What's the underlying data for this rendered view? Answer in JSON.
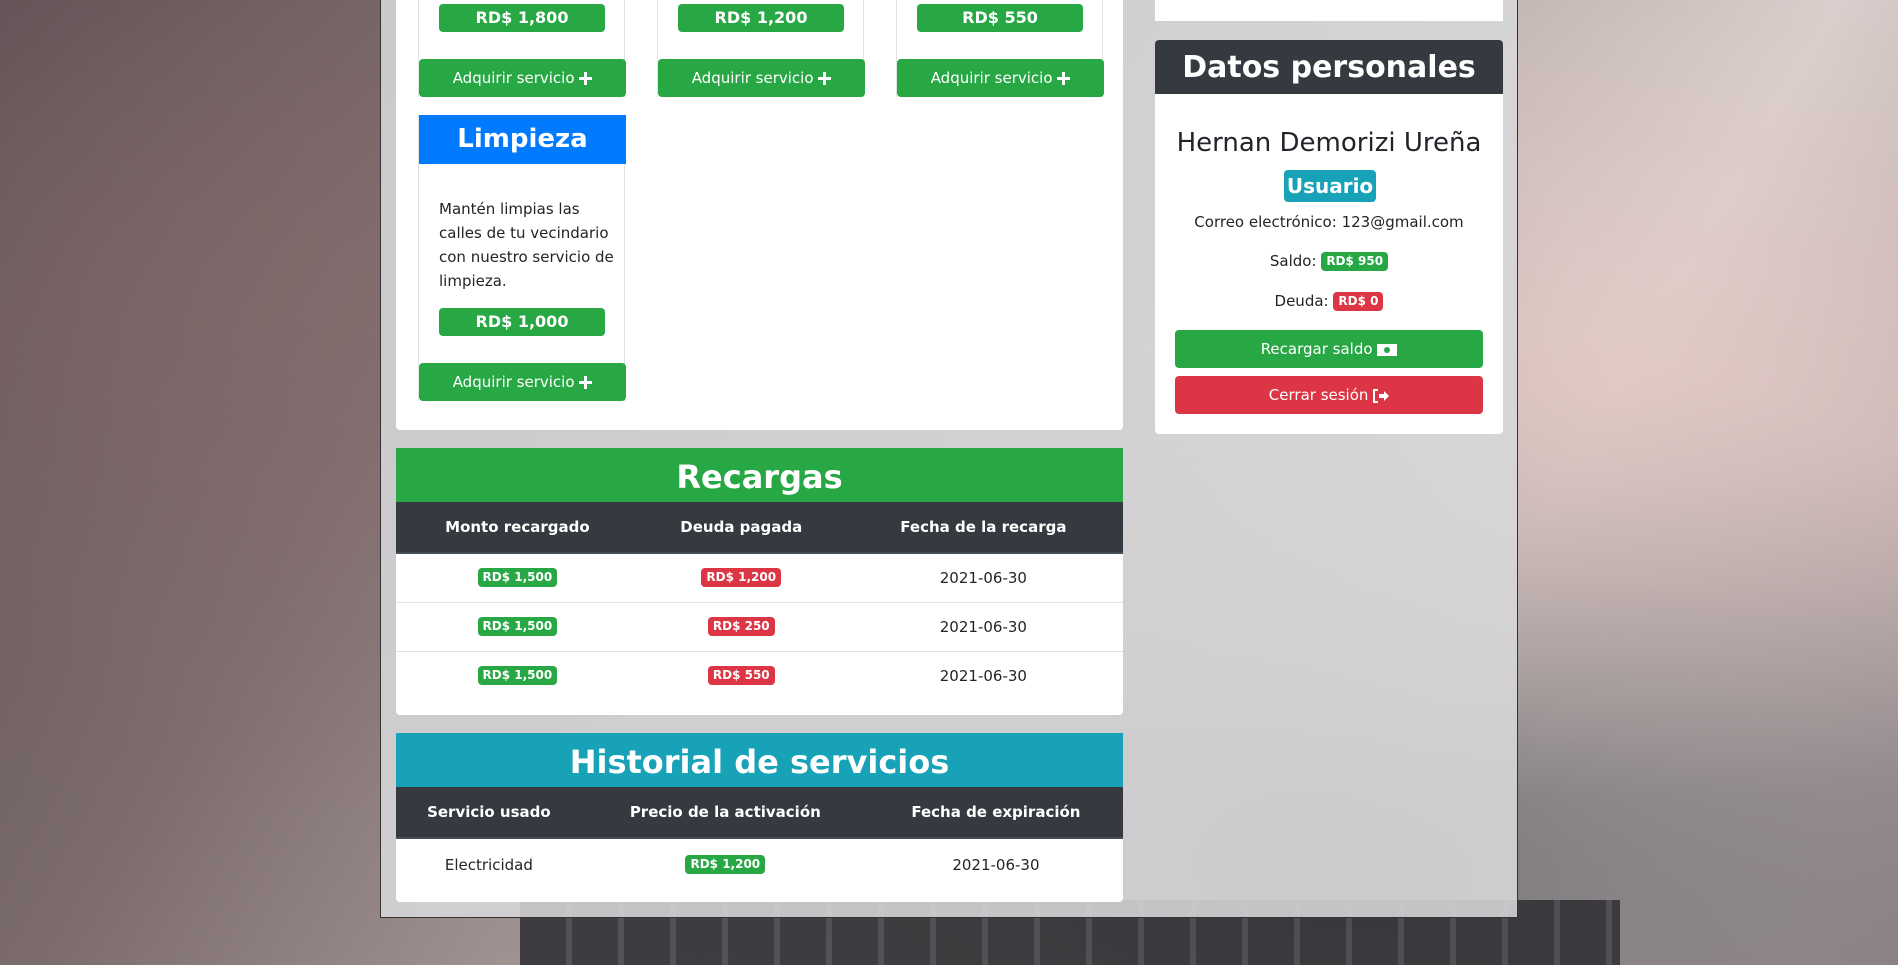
{
  "services": {
    "cards": [
      {
        "price": "RD$ 1,800",
        "button": "Adquirir servicio"
      },
      {
        "price": "RD$ 1,200",
        "button": "Adquirir servicio"
      },
      {
        "price": "RD$ 550",
        "button": "Adquirir servicio"
      }
    ],
    "limpieza": {
      "title": "Limpieza",
      "description": "Mantén limpias las calles de tu vecindario con nuestro servicio de limpieza.",
      "price": "RD$ 1,000",
      "button": "Adquirir servicio"
    }
  },
  "personal": {
    "title": "Datos personales",
    "name": "Hernan Demorizi Ureña",
    "role": "Usuario",
    "email_label": "Correo electrónico:",
    "email": "123@gmail.com",
    "balance_label": "Saldo:",
    "balance": "RD$ 950",
    "debt_label": "Deuda:",
    "debt": "RD$ 0",
    "recharge_button": "Recargar saldo",
    "logout_button": "Cerrar sesión"
  },
  "recargas": {
    "title": "Recargas",
    "columns": [
      "Monto recargado",
      "Deuda pagada",
      "Fecha de la recarga"
    ],
    "rows": [
      {
        "amount": "RD$ 1,500",
        "debt_paid": "RD$ 1,200",
        "date": "2021-06-30"
      },
      {
        "amount": "RD$ 1,500",
        "debt_paid": "RD$ 250",
        "date": "2021-06-30"
      },
      {
        "amount": "RD$ 1,500",
        "debt_paid": "RD$ 550",
        "date": "2021-06-30"
      }
    ]
  },
  "historial": {
    "title": "Historial de servicios",
    "columns": [
      "Servicio usado",
      "Precio de la activación",
      "Fecha de expiración"
    ],
    "rows": [
      {
        "service": "Electricidad",
        "price": "RD$ 1,200",
        "expiry": "2021-06-30"
      }
    ]
  },
  "colors": {
    "success": "#28a745",
    "danger": "#dc3545",
    "primary": "#007bff",
    "info": "#17a2b8",
    "dark": "#343a40"
  },
  "icons": [
    "plus-icon",
    "money-icon",
    "sign-out-icon"
  ]
}
